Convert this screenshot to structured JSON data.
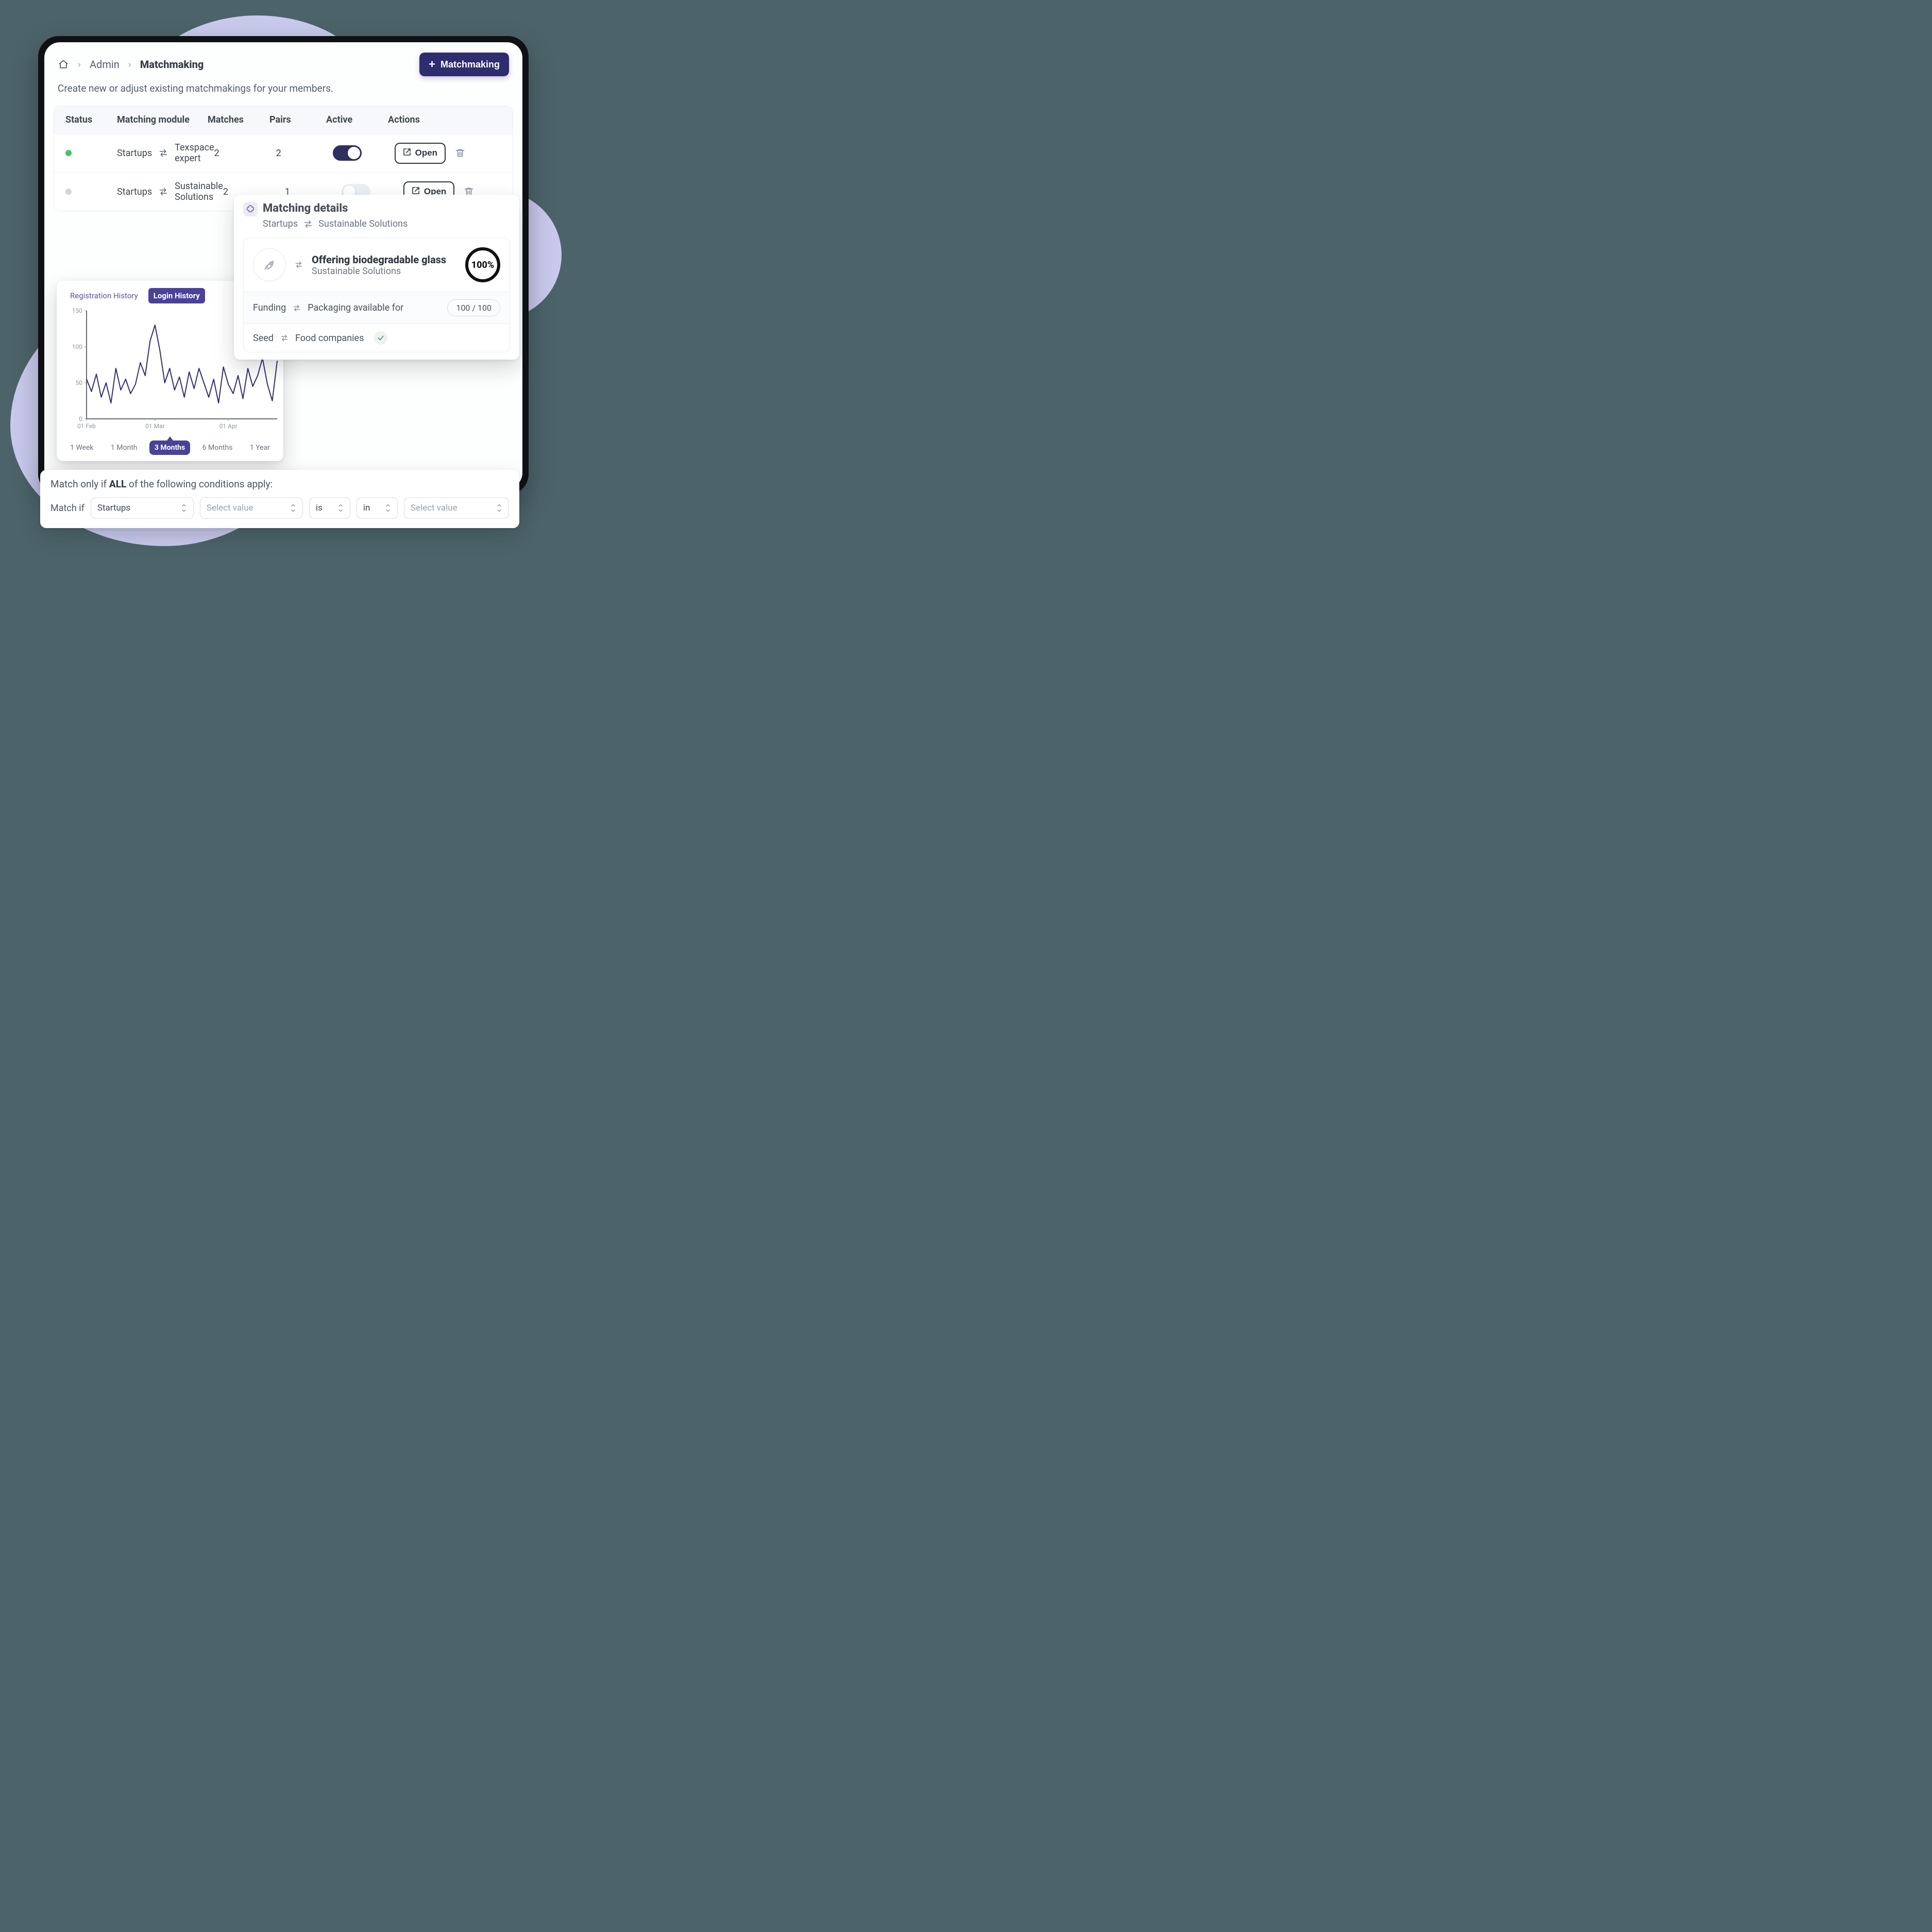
{
  "breadcrumb": {
    "admin": "Admin",
    "current": "Matchmaking"
  },
  "header": {
    "new_button": "Matchmaking"
  },
  "subtitle": "Create new or adjust existing matchmakings for your members.",
  "table": {
    "headers": {
      "status": "Status",
      "module": "Matching module",
      "matches": "Matches",
      "pairs": "Pairs",
      "active": "Active",
      "actions": "Actions"
    },
    "rows": [
      {
        "from": "Startups",
        "to": "Texspace expert",
        "matches": "2",
        "pairs": "2",
        "active": true,
        "open": "Open",
        "status": "green"
      },
      {
        "from": "Startups",
        "to": "Sustainable Solutions",
        "matches": "2",
        "pairs": "1",
        "active": false,
        "open": "Open",
        "status": "gray"
      }
    ]
  },
  "popover": {
    "title": "Matching details",
    "from": "Startups",
    "to": "Sustainable Solutions",
    "offer_title": "Offering biodegradable glass",
    "offer_sub": "Sustainable Solutions",
    "percent": "100%",
    "row1_left": "Funding",
    "row1_right": "Packaging available for",
    "row1_score": "100",
    "row1_total": "100",
    "row2_left": "Seed",
    "row2_right": "Food companies"
  },
  "chart_tabs": {
    "registration": "Registration History",
    "login": "Login History",
    "active": "login"
  },
  "chart_ranges": [
    "1 Week",
    "1 Month",
    "3 Months",
    "6 Months",
    "1 Year"
  ],
  "chart_active_range_index": 2,
  "chart_data": {
    "type": "line",
    "title": "",
    "xlabel": "",
    "ylabel": "",
    "ylim": [
      0,
      150
    ],
    "yticks": [
      0,
      50,
      100,
      150
    ],
    "x_tick_labels": [
      "01 Feb",
      "01 Mar",
      "01 Apr"
    ],
    "categories": [
      "01 Feb",
      "03 Feb",
      "05 Feb",
      "07 Feb",
      "09 Feb",
      "11 Feb",
      "13 Feb",
      "15 Feb",
      "17 Feb",
      "19 Feb",
      "21 Feb",
      "23 Feb",
      "25 Feb",
      "27 Feb",
      "01 Mar",
      "03 Mar",
      "05 Mar",
      "07 Mar",
      "09 Mar",
      "11 Mar",
      "13 Mar",
      "15 Mar",
      "17 Mar",
      "19 Mar",
      "21 Mar",
      "23 Mar",
      "25 Mar",
      "27 Mar",
      "29 Mar",
      "31 Mar",
      "02 Apr",
      "04 Apr",
      "06 Apr",
      "08 Apr",
      "10 Apr",
      "12 Apr",
      "14 Apr",
      "16 Apr",
      "18 Apr",
      "20 Apr"
    ],
    "values": [
      55,
      38,
      62,
      30,
      50,
      22,
      70,
      40,
      55,
      35,
      48,
      78,
      60,
      108,
      130,
      95,
      50,
      70,
      40,
      58,
      30,
      65,
      42,
      70,
      50,
      30,
      55,
      22,
      72,
      48,
      35,
      60,
      28,
      70,
      45,
      60,
      84,
      48,
      25,
      80
    ],
    "color": "#2e2e6f"
  },
  "rules": {
    "title_pre": "Match only if ",
    "title_bold": "ALL",
    "title_post": " of the following conditions apply:",
    "match_if": "Match if",
    "selects": {
      "startups": "Startups",
      "select_value": "Select value",
      "is": "is",
      "in": "in",
      "select_value2": "Select value"
    }
  }
}
